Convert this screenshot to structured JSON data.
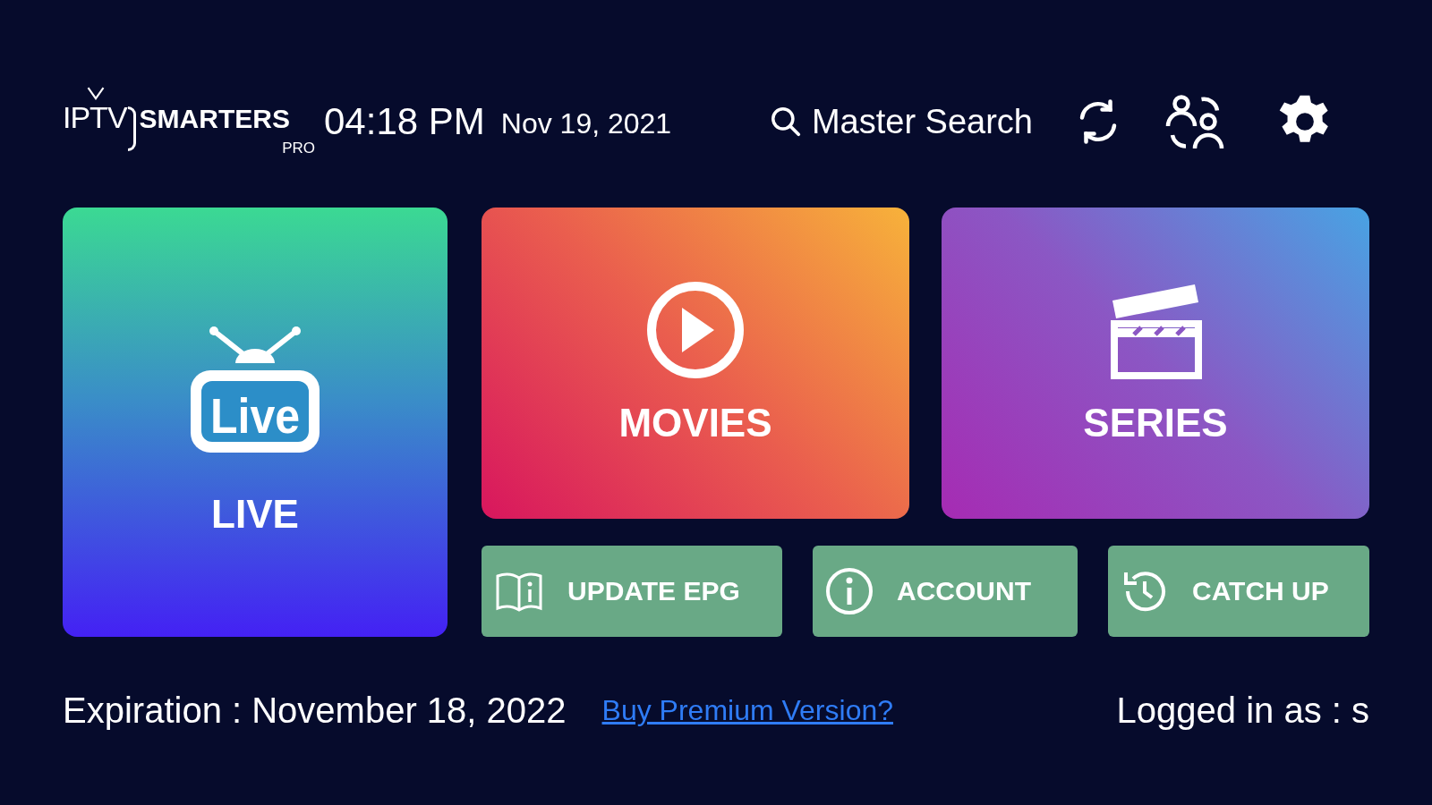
{
  "logo": {
    "brand": "IPTV",
    "name": "SMARTERS",
    "tag": "PRO"
  },
  "time": "04:18 PM",
  "date": "Nov 19, 2021",
  "search": {
    "label": "Master Search"
  },
  "tiles": [
    {
      "kind": "live",
      "label": "LIVE",
      "icon_text": "Live"
    },
    {
      "kind": "movies",
      "label": "MOVIES"
    },
    {
      "kind": "series",
      "label": "SERIES"
    }
  ],
  "buttons": [
    {
      "kind": "epg",
      "label": "UPDATE EPG"
    },
    {
      "kind": "account",
      "label": "ACCOUNT"
    },
    {
      "kind": "catchup",
      "label": "CATCH UP"
    }
  ],
  "expiration": "Expiration : November 18, 2022",
  "premium_link": "Buy Premium Version?",
  "logged_in": "Logged in as : s"
}
